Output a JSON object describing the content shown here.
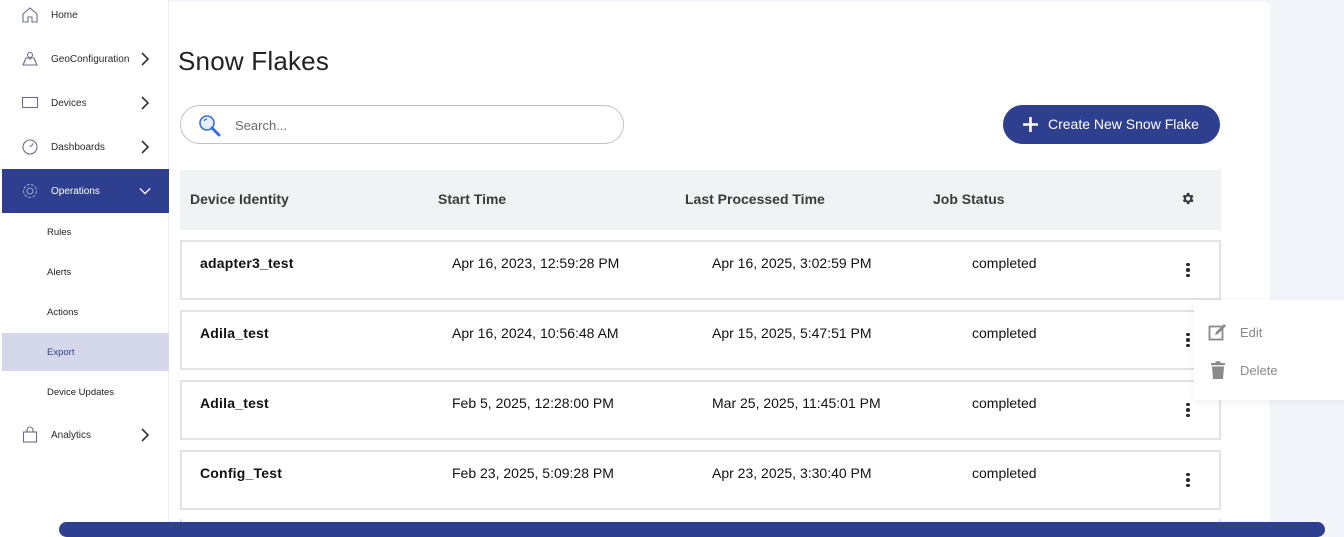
{
  "sidebar": {
    "items": [
      {
        "label": "Home",
        "icon": "home-icon"
      },
      {
        "label": "GeoConfiguration",
        "icon": "map-icon"
      },
      {
        "label": "Devices",
        "icon": "monitor-icon"
      },
      {
        "label": "Dashboards",
        "icon": "speedometer-icon"
      },
      {
        "label": "Operations",
        "icon": "gear-outline-icon"
      },
      {
        "label": "Analytics",
        "icon": "shopping-bag-icon"
      }
    ],
    "sub_items": [
      "Rules",
      "Alerts",
      "Actions",
      "Export",
      "Device Updates"
    ],
    "selected_sub_item": "Export",
    "active_item": "Operations"
  },
  "page": {
    "title": "Snow Flakes"
  },
  "search": {
    "placeholder": "Search..."
  },
  "create_button": {
    "label": "Create New Snow Flake"
  },
  "table": {
    "headers": [
      "Device Identity",
      "Start Time",
      "Last Processed Time",
      "Job Status"
    ],
    "rows": [
      {
        "device": "adapter3_test",
        "start": "Apr 16, 2023, 12:59:28 PM",
        "last": "Apr 16, 2025, 3:02:59 PM",
        "status": "completed"
      },
      {
        "device": "Adila_test",
        "start": "Apr 16, 2024, 10:56:48 AM",
        "last": "Apr 15, 2025, 5:47:51 PM",
        "status": "completed"
      },
      {
        "device": "Adila_test",
        "start": "Feb 5, 2025, 12:28:00 PM",
        "last": "Mar 25, 2025, 11:45:01 PM",
        "status": "completed"
      },
      {
        "device": "Config_Test",
        "start": "Feb 23, 2025, 5:09:28 PM",
        "last": "Apr 23, 2025, 3:30:40 PM",
        "status": "completed"
      }
    ]
  },
  "context_menu": {
    "edit": "Edit",
    "delete": "Delete"
  },
  "colors": {
    "accent": "#2f3f8f",
    "selected_sub_bg": "#d4d8ea",
    "header_bg": "#f1f2f4"
  }
}
